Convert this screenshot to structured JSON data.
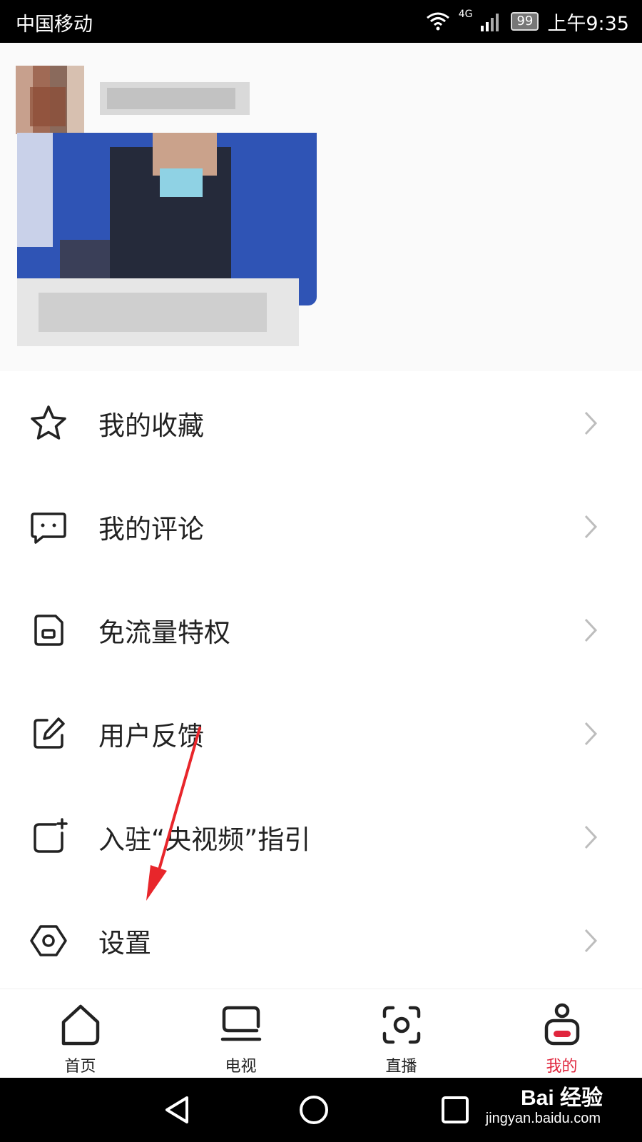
{
  "status_bar": {
    "carrier": "中国移动",
    "network": "4G",
    "battery": "99",
    "time": "上午9:35"
  },
  "menu": {
    "items": [
      {
        "label": "我的收藏",
        "icon": "star-icon"
      },
      {
        "label": "我的评论",
        "icon": "comment-icon"
      },
      {
        "label": "免流量特权",
        "icon": "sim-card-icon"
      },
      {
        "label": "用户反馈",
        "icon": "edit-icon"
      },
      {
        "label": "入驻“央视频”指引",
        "icon": "add-square-icon"
      },
      {
        "label": "设置",
        "icon": "settings-hexagon-icon"
      }
    ]
  },
  "tabbar": {
    "tabs": [
      {
        "label": "首页",
        "icon": "home-icon",
        "active": false
      },
      {
        "label": "电视",
        "icon": "tv-icon",
        "active": false
      },
      {
        "label": "直播",
        "icon": "live-icon",
        "active": false
      },
      {
        "label": "我的",
        "icon": "profile-icon",
        "active": true
      }
    ]
  },
  "watermark": {
    "brand": "Bai  经验",
    "url": "jingyan.baidu.com"
  },
  "colors": {
    "accent": "#e0263d",
    "annotation_arrow": "#e8262b"
  }
}
